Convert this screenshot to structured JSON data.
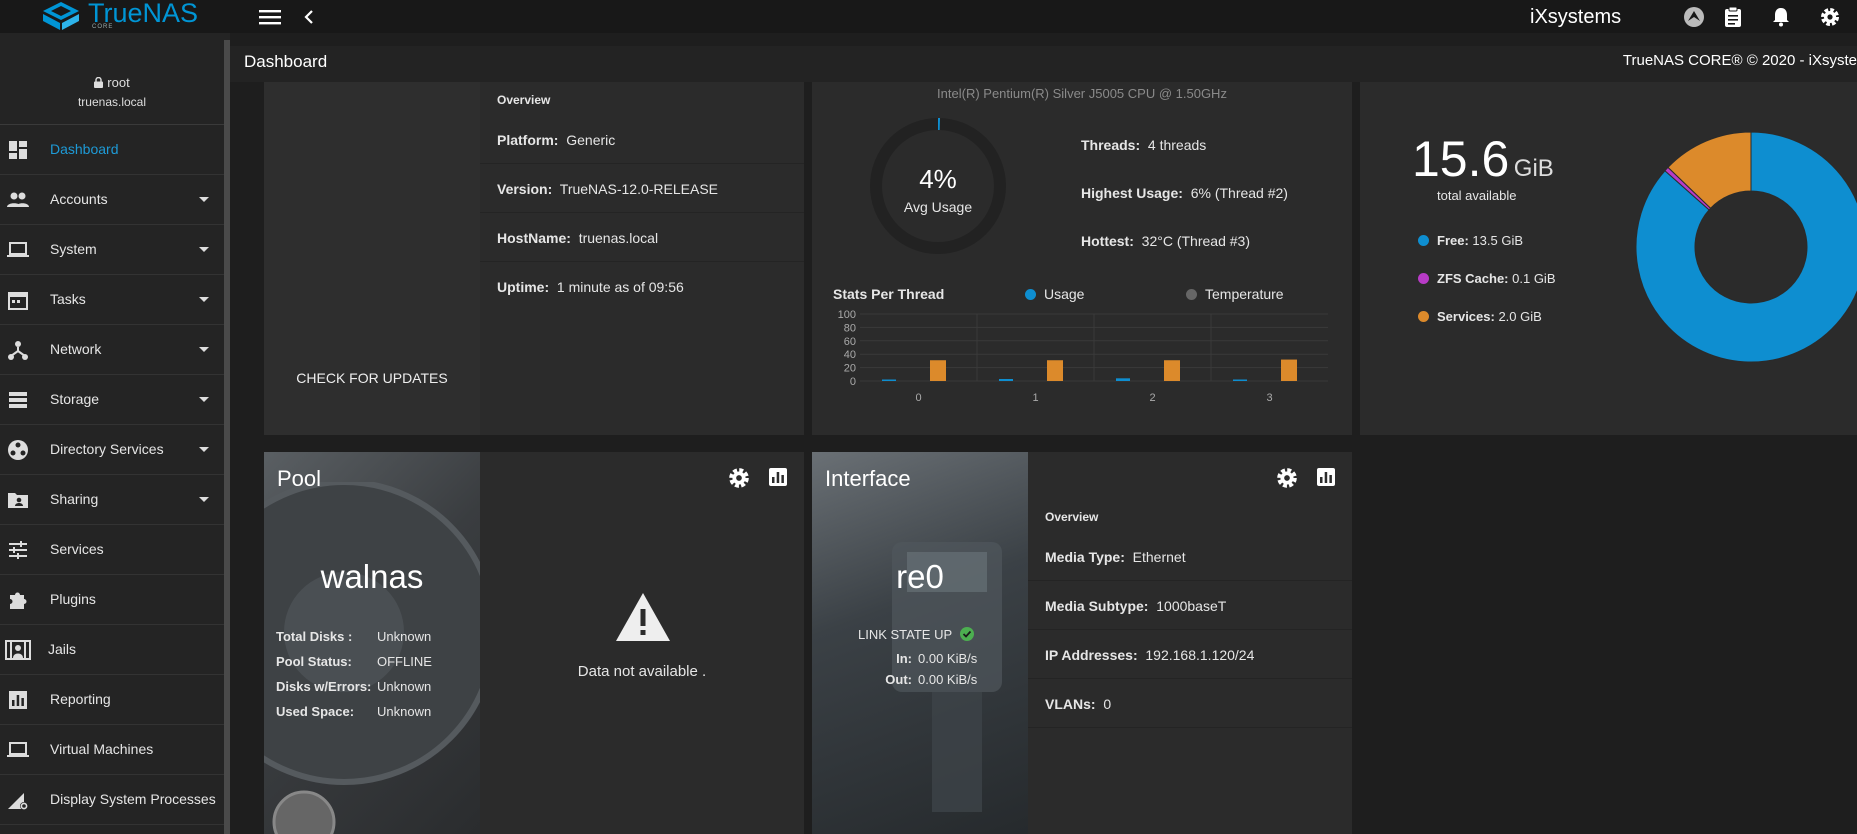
{
  "topbar": {
    "brand": "TrueNAS",
    "brand_sub": "CORE",
    "vendor_logo_a": "iX",
    "vendor_logo_b": "systems"
  },
  "titlebar": {
    "title": "Dashboard",
    "copyright": "TrueNAS CORE® © 2020 - iXsyste"
  },
  "user": {
    "name": "root",
    "host": "truenas.local"
  },
  "sidebar": {
    "items": [
      {
        "label": "Dashboard",
        "icon": "dashboard-icon",
        "active": true
      },
      {
        "label": "Accounts",
        "icon": "people-icon"
      },
      {
        "label": "System",
        "icon": "laptop-icon"
      },
      {
        "label": "Tasks",
        "icon": "calendar-icon"
      },
      {
        "label": "Network",
        "icon": "network-icon"
      },
      {
        "label": "Storage",
        "icon": "storage-icon"
      },
      {
        "label": "Directory Services",
        "icon": "directory-icon"
      },
      {
        "label": "Sharing",
        "icon": "folder-share-icon"
      },
      {
        "label": "Services",
        "icon": "tune-icon"
      },
      {
        "label": "Plugins",
        "icon": "puzzle-icon"
      },
      {
        "label": "Jails",
        "icon": "jail-icon"
      },
      {
        "label": "Reporting",
        "icon": "bar-chart-icon"
      },
      {
        "label": "Virtual Machines",
        "icon": "laptop-icon"
      },
      {
        "label": "Display System Processes",
        "icon": "processes-icon"
      }
    ]
  },
  "sysinfo": {
    "update_button": "CHECK FOR UPDATES",
    "overview": "Overview",
    "platform_label": "Platform:",
    "platform": "Generic",
    "version_label": "Version:",
    "version": "TrueNAS-12.0-RELEASE",
    "hostname_label": "HostName:",
    "hostname": "truenas.local",
    "uptime_label": "Uptime:",
    "uptime": "1 minute as of 09:56"
  },
  "cpu": {
    "model": "Intel(R) Pentium(R) Silver J5005 CPU @ 1.50GHz",
    "avg_value": "4%",
    "avg_label": "Avg Usage",
    "avg_fraction": 0.04,
    "threads_label": "Threads:",
    "threads": "4 threads",
    "highest_label": "Highest Usage:",
    "highest": "6%  (Thread #2)",
    "hottest_label": "Hottest:",
    "hottest": "32°C  (Thread #3)",
    "stats_title": "Stats Per Thread",
    "legend_usage": "Usage",
    "legend_temp": "Temperature"
  },
  "chart_data": {
    "type": "bar",
    "categories": [
      "0",
      "1",
      "2",
      "3"
    ],
    "series": [
      {
        "name": "Usage",
        "values": [
          2,
          3,
          4,
          1
        ],
        "color": "#0e8ed0"
      },
      {
        "name": "Temperature",
        "values": [
          31,
          31,
          31,
          32
        ],
        "color": "#dc8a2b"
      }
    ],
    "yticks": [
      "100",
      "80",
      "60",
      "40",
      "20",
      "0"
    ],
    "ylim": [
      0,
      100
    ]
  },
  "memory": {
    "total": "15.6",
    "unit": "GiB",
    "total_label": "total available",
    "free_label": "Free:",
    "free": "13.5 GiB",
    "zfs_label": "ZFS Cache:",
    "zfs": "0.1 GiB",
    "services_label": "Services:",
    "services": "2.0 GiB",
    "pie": [
      {
        "name": "Free",
        "value": 13.5,
        "color": "#0e8ed0"
      },
      {
        "name": "ZFS Cache",
        "value": 0.1,
        "color": "#b83bc7"
      },
      {
        "name": "Services",
        "value": 2.0,
        "color": "#dc8a2b"
      }
    ]
  },
  "pool": {
    "title": "Pool",
    "name": "walnas",
    "total_disks_label": "Total Disks :",
    "total_disks": "Unknown",
    "status_label": "Pool Status:",
    "status": "OFFLINE",
    "errors_label": "Disks w/Errors:",
    "errors": "Unknown",
    "used_label": "Used Space:",
    "used": "Unknown",
    "not_available": "Data not available ."
  },
  "interface": {
    "title": "Interface",
    "name": "re0",
    "link_state": "LINK STATE UP",
    "in_label": "In:",
    "in": "0.00 KiB/s",
    "out_label": "Out:",
    "out": "0.00 KiB/s",
    "overview": "Overview",
    "media_type_label": "Media Type:",
    "media_type": "Ethernet",
    "media_subtype_label": "Media Subtype:",
    "media_subtype": "1000baseT",
    "ip_label": "IP Addresses:",
    "ip": "192.168.1.120/24",
    "vlans_label": "VLANs:",
    "vlans": "0"
  },
  "colors": {
    "accent": "#0095d5",
    "orange": "#dc8a2b",
    "purple": "#b83bc7",
    "green": "#4caf50"
  }
}
